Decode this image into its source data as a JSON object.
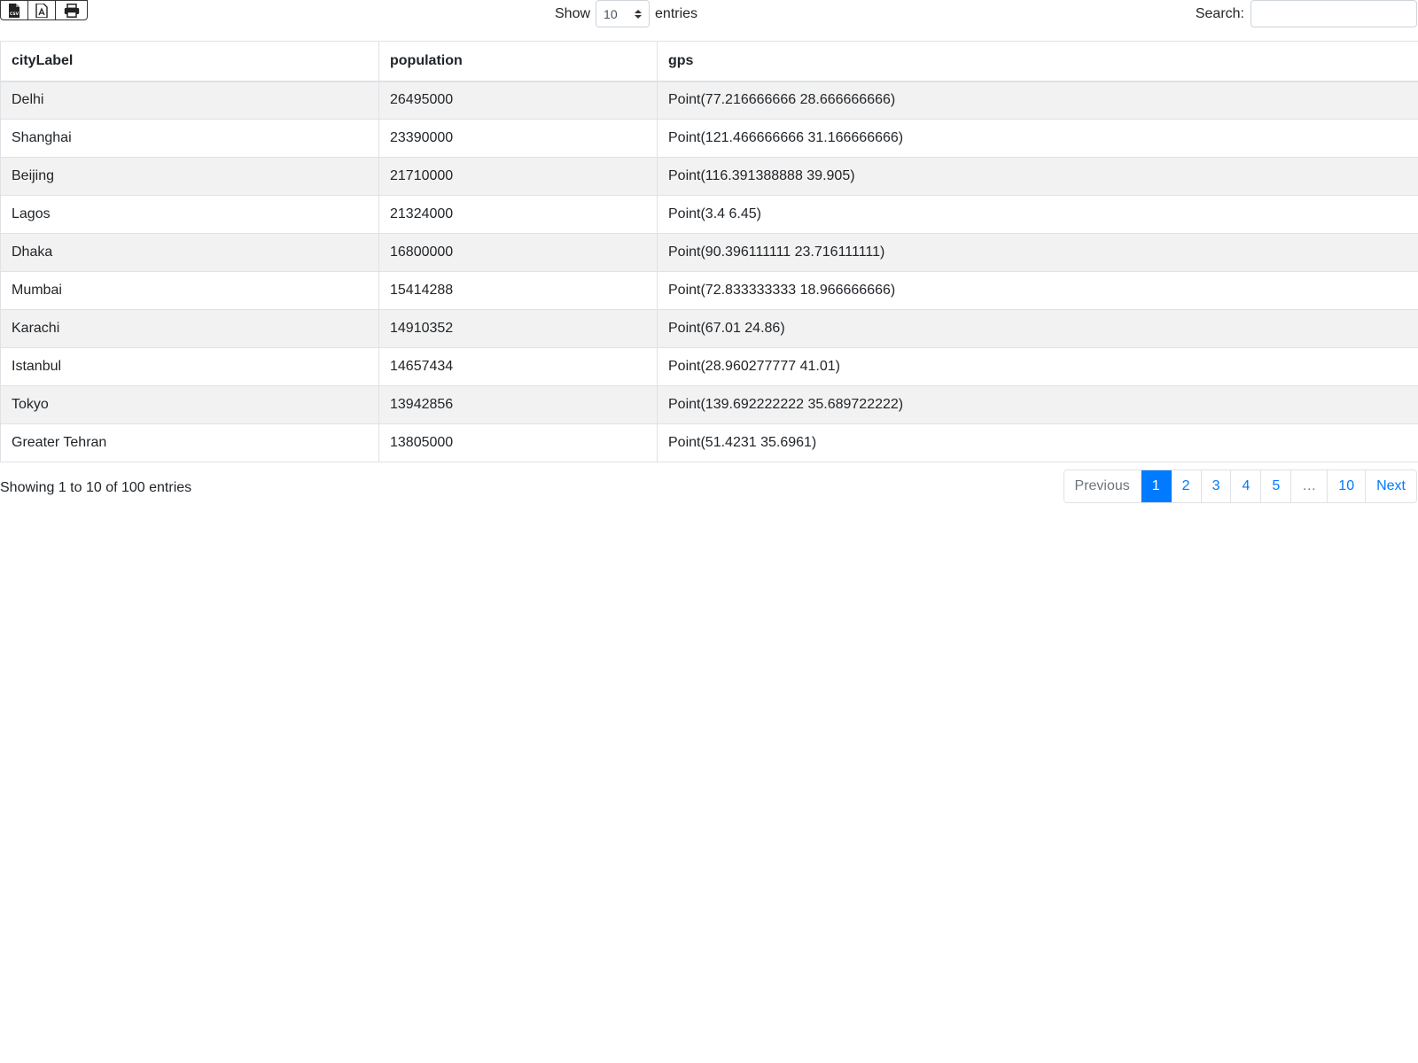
{
  "toolbar": {
    "export_buttons": [
      {
        "icon": "csv-file-icon"
      },
      {
        "icon": "pdf-file-icon"
      },
      {
        "icon": "print-icon"
      }
    ]
  },
  "length_menu": {
    "prefix": "Show",
    "selected": "10",
    "suffix": "entries"
  },
  "search": {
    "label": "Search:",
    "value": "",
    "placeholder": ""
  },
  "table": {
    "headers": [
      "cityLabel",
      "population",
      "gps"
    ],
    "rows": [
      [
        "Delhi",
        "26495000",
        "Point(77.216666666 28.666666666)"
      ],
      [
        "Shanghai",
        "23390000",
        "Point(121.466666666 31.166666666)"
      ],
      [
        "Beijing",
        "21710000",
        "Point(116.391388888 39.905)"
      ],
      [
        "Lagos",
        "21324000",
        "Point(3.4 6.45)"
      ],
      [
        "Dhaka",
        "16800000",
        "Point(90.396111111 23.716111111)"
      ],
      [
        "Mumbai",
        "15414288",
        "Point(72.833333333 18.966666666)"
      ],
      [
        "Karachi",
        "14910352",
        "Point(67.01 24.86)"
      ],
      [
        "Istanbul",
        "14657434",
        "Point(28.960277777 41.01)"
      ],
      [
        "Tokyo",
        "13942856",
        "Point(139.692222222 35.689722222)"
      ],
      [
        "Greater Tehran",
        "13805000",
        "Point(51.4231 35.6961)"
      ]
    ]
  },
  "footer": {
    "info": "Showing 1 to 10 of 100 entries",
    "pagination": {
      "previous": "Previous",
      "pages": [
        "1",
        "2",
        "3",
        "4",
        "5",
        "…",
        "10"
      ],
      "active_page": "1",
      "next": "Next"
    }
  },
  "colors": {
    "accent": "#007bff",
    "stripe": "#f2f2f2",
    "border": "#dee2e6"
  }
}
